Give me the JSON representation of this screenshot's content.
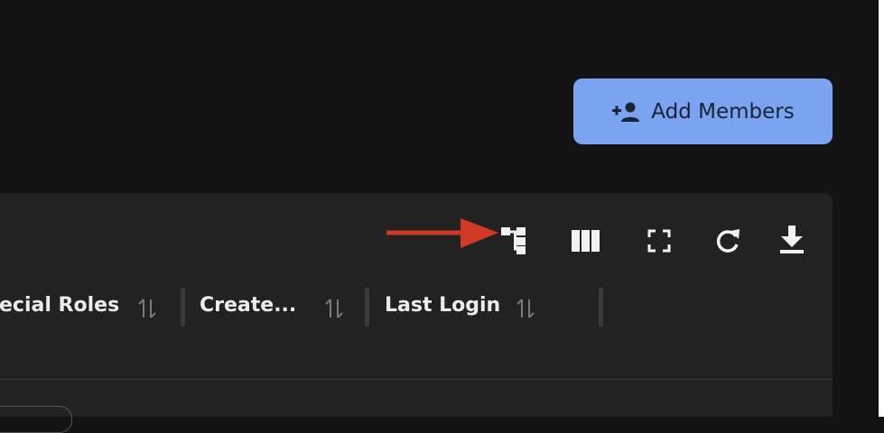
{
  "header": {
    "add_members_label": "Add Members",
    "add_members_icon": "person-add-icon",
    "accent_color": "#7aa3f0"
  },
  "toolbar": {
    "icons": [
      "hierarchy-icon",
      "columns-icon",
      "fullscreen-icon",
      "refresh-icon",
      "download-icon"
    ],
    "annotation_arrow_color": "#d03a25"
  },
  "table": {
    "columns": [
      {
        "label": "ecial Roles",
        "sort_icon": "sort-icon"
      },
      {
        "label": "Create...",
        "sort_icon": "sort-icon"
      },
      {
        "label": "Last Login",
        "sort_icon": "sort-icon"
      }
    ]
  }
}
